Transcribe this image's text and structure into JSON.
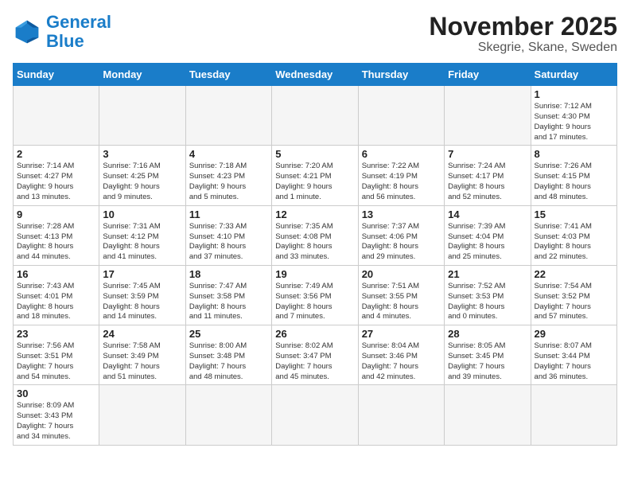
{
  "header": {
    "logo_general": "General",
    "logo_blue": "Blue",
    "title": "November 2025",
    "subtitle": "Skegrie, Skane, Sweden"
  },
  "days_of_week": [
    "Sunday",
    "Monday",
    "Tuesday",
    "Wednesday",
    "Thursday",
    "Friday",
    "Saturday"
  ],
  "weeks": [
    [
      {
        "day": "",
        "info": ""
      },
      {
        "day": "",
        "info": ""
      },
      {
        "day": "",
        "info": ""
      },
      {
        "day": "",
        "info": ""
      },
      {
        "day": "",
        "info": ""
      },
      {
        "day": "",
        "info": ""
      },
      {
        "day": "1",
        "info": "Sunrise: 7:12 AM\nSunset: 4:30 PM\nDaylight: 9 hours\nand 17 minutes."
      }
    ],
    [
      {
        "day": "2",
        "info": "Sunrise: 7:14 AM\nSunset: 4:27 PM\nDaylight: 9 hours\nand 13 minutes."
      },
      {
        "day": "3",
        "info": "Sunrise: 7:16 AM\nSunset: 4:25 PM\nDaylight: 9 hours\nand 9 minutes."
      },
      {
        "day": "4",
        "info": "Sunrise: 7:18 AM\nSunset: 4:23 PM\nDaylight: 9 hours\nand 5 minutes."
      },
      {
        "day": "5",
        "info": "Sunrise: 7:20 AM\nSunset: 4:21 PM\nDaylight: 9 hours\nand 1 minute."
      },
      {
        "day": "6",
        "info": "Sunrise: 7:22 AM\nSunset: 4:19 PM\nDaylight: 8 hours\nand 56 minutes."
      },
      {
        "day": "7",
        "info": "Sunrise: 7:24 AM\nSunset: 4:17 PM\nDaylight: 8 hours\nand 52 minutes."
      },
      {
        "day": "8",
        "info": "Sunrise: 7:26 AM\nSunset: 4:15 PM\nDaylight: 8 hours\nand 48 minutes."
      }
    ],
    [
      {
        "day": "9",
        "info": "Sunrise: 7:28 AM\nSunset: 4:13 PM\nDaylight: 8 hours\nand 44 minutes."
      },
      {
        "day": "10",
        "info": "Sunrise: 7:31 AM\nSunset: 4:12 PM\nDaylight: 8 hours\nand 41 minutes."
      },
      {
        "day": "11",
        "info": "Sunrise: 7:33 AM\nSunset: 4:10 PM\nDaylight: 8 hours\nand 37 minutes."
      },
      {
        "day": "12",
        "info": "Sunrise: 7:35 AM\nSunset: 4:08 PM\nDaylight: 8 hours\nand 33 minutes."
      },
      {
        "day": "13",
        "info": "Sunrise: 7:37 AM\nSunset: 4:06 PM\nDaylight: 8 hours\nand 29 minutes."
      },
      {
        "day": "14",
        "info": "Sunrise: 7:39 AM\nSunset: 4:04 PM\nDaylight: 8 hours\nand 25 minutes."
      },
      {
        "day": "15",
        "info": "Sunrise: 7:41 AM\nSunset: 4:03 PM\nDaylight: 8 hours\nand 22 minutes."
      }
    ],
    [
      {
        "day": "16",
        "info": "Sunrise: 7:43 AM\nSunset: 4:01 PM\nDaylight: 8 hours\nand 18 minutes."
      },
      {
        "day": "17",
        "info": "Sunrise: 7:45 AM\nSunset: 3:59 PM\nDaylight: 8 hours\nand 14 minutes."
      },
      {
        "day": "18",
        "info": "Sunrise: 7:47 AM\nSunset: 3:58 PM\nDaylight: 8 hours\nand 11 minutes."
      },
      {
        "day": "19",
        "info": "Sunrise: 7:49 AM\nSunset: 3:56 PM\nDaylight: 8 hours\nand 7 minutes."
      },
      {
        "day": "20",
        "info": "Sunrise: 7:51 AM\nSunset: 3:55 PM\nDaylight: 8 hours\nand 4 minutes."
      },
      {
        "day": "21",
        "info": "Sunrise: 7:52 AM\nSunset: 3:53 PM\nDaylight: 8 hours\nand 0 minutes."
      },
      {
        "day": "22",
        "info": "Sunrise: 7:54 AM\nSunset: 3:52 PM\nDaylight: 7 hours\nand 57 minutes."
      }
    ],
    [
      {
        "day": "23",
        "info": "Sunrise: 7:56 AM\nSunset: 3:51 PM\nDaylight: 7 hours\nand 54 minutes."
      },
      {
        "day": "24",
        "info": "Sunrise: 7:58 AM\nSunset: 3:49 PM\nDaylight: 7 hours\nand 51 minutes."
      },
      {
        "day": "25",
        "info": "Sunrise: 8:00 AM\nSunset: 3:48 PM\nDaylight: 7 hours\nand 48 minutes."
      },
      {
        "day": "26",
        "info": "Sunrise: 8:02 AM\nSunset: 3:47 PM\nDaylight: 7 hours\nand 45 minutes."
      },
      {
        "day": "27",
        "info": "Sunrise: 8:04 AM\nSunset: 3:46 PM\nDaylight: 7 hours\nand 42 minutes."
      },
      {
        "day": "28",
        "info": "Sunrise: 8:05 AM\nSunset: 3:45 PM\nDaylight: 7 hours\nand 39 minutes."
      },
      {
        "day": "29",
        "info": "Sunrise: 8:07 AM\nSunset: 3:44 PM\nDaylight: 7 hours\nand 36 minutes."
      }
    ],
    [
      {
        "day": "30",
        "info": "Sunrise: 8:09 AM\nSunset: 3:43 PM\nDaylight: 7 hours\nand 34 minutes."
      },
      {
        "day": "",
        "info": ""
      },
      {
        "day": "",
        "info": ""
      },
      {
        "day": "",
        "info": ""
      },
      {
        "day": "",
        "info": ""
      },
      {
        "day": "",
        "info": ""
      },
      {
        "day": "",
        "info": ""
      }
    ]
  ]
}
